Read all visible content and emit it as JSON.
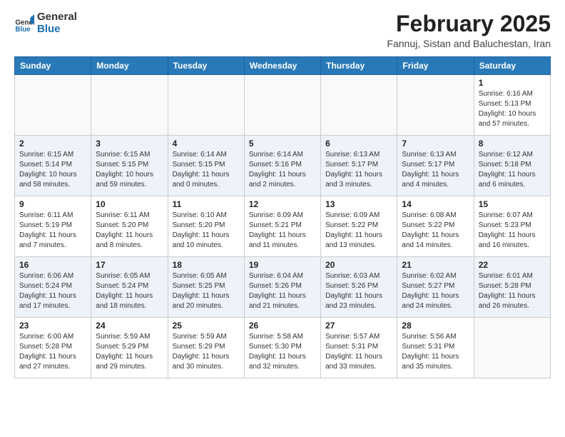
{
  "header": {
    "logo_general": "General",
    "logo_blue": "Blue",
    "month_title": "February 2025",
    "subtitle": "Fannuj, Sistan and Baluchestan, Iran"
  },
  "weekdays": [
    "Sunday",
    "Monday",
    "Tuesday",
    "Wednesday",
    "Thursday",
    "Friday",
    "Saturday"
  ],
  "weeks": [
    [
      {
        "day": "",
        "info": ""
      },
      {
        "day": "",
        "info": ""
      },
      {
        "day": "",
        "info": ""
      },
      {
        "day": "",
        "info": ""
      },
      {
        "day": "",
        "info": ""
      },
      {
        "day": "",
        "info": ""
      },
      {
        "day": "1",
        "info": "Sunrise: 6:16 AM\nSunset: 5:13 PM\nDaylight: 10 hours and 57 minutes."
      }
    ],
    [
      {
        "day": "2",
        "info": "Sunrise: 6:15 AM\nSunset: 5:14 PM\nDaylight: 10 hours and 58 minutes."
      },
      {
        "day": "3",
        "info": "Sunrise: 6:15 AM\nSunset: 5:15 PM\nDaylight: 10 hours and 59 minutes."
      },
      {
        "day": "4",
        "info": "Sunrise: 6:14 AM\nSunset: 5:15 PM\nDaylight: 11 hours and 0 minutes."
      },
      {
        "day": "5",
        "info": "Sunrise: 6:14 AM\nSunset: 5:16 PM\nDaylight: 11 hours and 2 minutes."
      },
      {
        "day": "6",
        "info": "Sunrise: 6:13 AM\nSunset: 5:17 PM\nDaylight: 11 hours and 3 minutes."
      },
      {
        "day": "7",
        "info": "Sunrise: 6:13 AM\nSunset: 5:17 PM\nDaylight: 11 hours and 4 minutes."
      },
      {
        "day": "8",
        "info": "Sunrise: 6:12 AM\nSunset: 5:18 PM\nDaylight: 11 hours and 6 minutes."
      }
    ],
    [
      {
        "day": "9",
        "info": "Sunrise: 6:11 AM\nSunset: 5:19 PM\nDaylight: 11 hours and 7 minutes."
      },
      {
        "day": "10",
        "info": "Sunrise: 6:11 AM\nSunset: 5:20 PM\nDaylight: 11 hours and 8 minutes."
      },
      {
        "day": "11",
        "info": "Sunrise: 6:10 AM\nSunset: 5:20 PM\nDaylight: 11 hours and 10 minutes."
      },
      {
        "day": "12",
        "info": "Sunrise: 6:09 AM\nSunset: 5:21 PM\nDaylight: 11 hours and 11 minutes."
      },
      {
        "day": "13",
        "info": "Sunrise: 6:09 AM\nSunset: 5:22 PM\nDaylight: 11 hours and 13 minutes."
      },
      {
        "day": "14",
        "info": "Sunrise: 6:08 AM\nSunset: 5:22 PM\nDaylight: 11 hours and 14 minutes."
      },
      {
        "day": "15",
        "info": "Sunrise: 6:07 AM\nSunset: 5:23 PM\nDaylight: 11 hours and 16 minutes."
      }
    ],
    [
      {
        "day": "16",
        "info": "Sunrise: 6:06 AM\nSunset: 5:24 PM\nDaylight: 11 hours and 17 minutes."
      },
      {
        "day": "17",
        "info": "Sunrise: 6:05 AM\nSunset: 5:24 PM\nDaylight: 11 hours and 18 minutes."
      },
      {
        "day": "18",
        "info": "Sunrise: 6:05 AM\nSunset: 5:25 PM\nDaylight: 11 hours and 20 minutes."
      },
      {
        "day": "19",
        "info": "Sunrise: 6:04 AM\nSunset: 5:26 PM\nDaylight: 11 hours and 21 minutes."
      },
      {
        "day": "20",
        "info": "Sunrise: 6:03 AM\nSunset: 5:26 PM\nDaylight: 11 hours and 23 minutes."
      },
      {
        "day": "21",
        "info": "Sunrise: 6:02 AM\nSunset: 5:27 PM\nDaylight: 11 hours and 24 minutes."
      },
      {
        "day": "22",
        "info": "Sunrise: 6:01 AM\nSunset: 5:28 PM\nDaylight: 11 hours and 26 minutes."
      }
    ],
    [
      {
        "day": "23",
        "info": "Sunrise: 6:00 AM\nSunset: 5:28 PM\nDaylight: 11 hours and 27 minutes."
      },
      {
        "day": "24",
        "info": "Sunrise: 5:59 AM\nSunset: 5:29 PM\nDaylight: 11 hours and 29 minutes."
      },
      {
        "day": "25",
        "info": "Sunrise: 5:59 AM\nSunset: 5:29 PM\nDaylight: 11 hours and 30 minutes."
      },
      {
        "day": "26",
        "info": "Sunrise: 5:58 AM\nSunset: 5:30 PM\nDaylight: 11 hours and 32 minutes."
      },
      {
        "day": "27",
        "info": "Sunrise: 5:57 AM\nSunset: 5:31 PM\nDaylight: 11 hours and 33 minutes."
      },
      {
        "day": "28",
        "info": "Sunrise: 5:56 AM\nSunset: 5:31 PM\nDaylight: 11 hours and 35 minutes."
      },
      {
        "day": "",
        "info": ""
      }
    ]
  ]
}
